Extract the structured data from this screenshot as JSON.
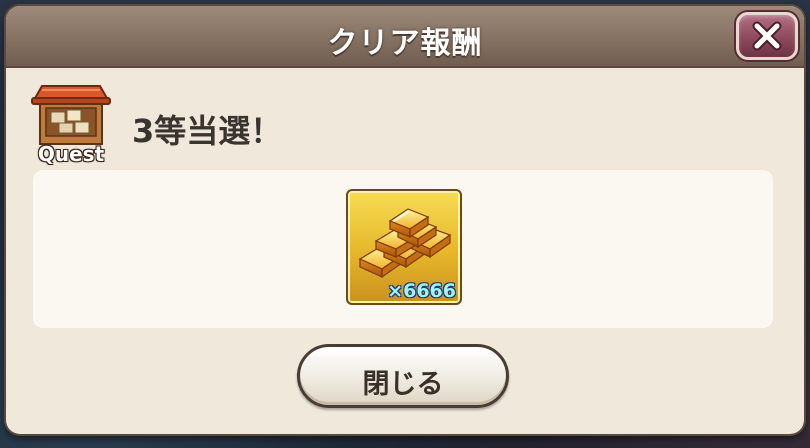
{
  "dialog": {
    "title": "クリア報酬",
    "close_icon": "close-x-icon"
  },
  "quest": {
    "icon": "quest-shop-icon",
    "label": "Quest"
  },
  "result": {
    "text": "3等当選！"
  },
  "reward": {
    "icon": "gold-bars-icon",
    "count": "×6666"
  },
  "footer": {
    "close_label": "閉じる"
  },
  "colors": {
    "title_bar": "#857262",
    "close_button": "#8d4a5d",
    "panel_bg": "#efe8db",
    "item_tile": "#e7b72a",
    "count_text": "#9ff3ff"
  }
}
